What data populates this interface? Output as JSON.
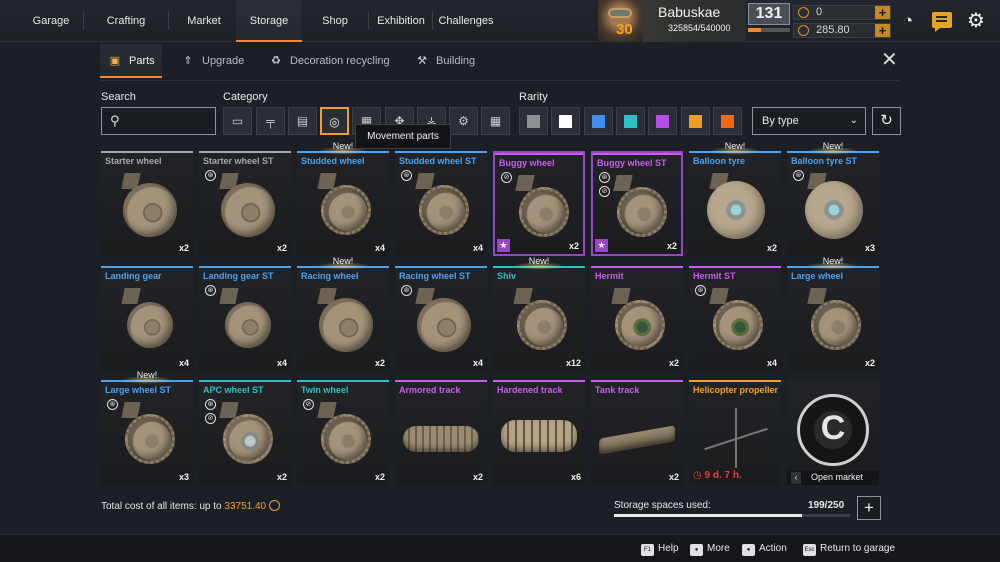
{
  "nav": {
    "items": [
      {
        "label": "Garage"
      },
      {
        "label": "Crafting"
      },
      {
        "label": "Market"
      },
      {
        "label": "Storage"
      },
      {
        "label": "Shop"
      },
      {
        "label": "Exhibition"
      },
      {
        "label": "Challenges"
      }
    ],
    "active": "Storage"
  },
  "profile": {
    "name": "Babuskae",
    "level": "30",
    "xp": "325854/540000",
    "rank": "131",
    "rank_progress": 0.3
  },
  "currencies": [
    {
      "icon": "coin-icon",
      "value": "0"
    },
    {
      "icon": "coin-icon",
      "value": "285.80"
    }
  ],
  "subtabs": [
    {
      "label": "Parts",
      "icon": "parts-icon"
    },
    {
      "label": "Upgrade",
      "icon": "upgrade-icon"
    },
    {
      "label": "Decoration recycling",
      "icon": "recycle-icon"
    },
    {
      "label": "Building",
      "icon": "building-icon"
    }
  ],
  "filters": {
    "search_label": "Search",
    "search_value": "",
    "category_label": "Category",
    "rarity_label": "Rarity",
    "sort_value": "By type",
    "tooltip": "Movement parts",
    "category_icons": [
      "cabin-icon",
      "weapon-icon",
      "module-icon",
      "wheel-icon",
      "frame-icon",
      "wing-icon",
      "engine-icon",
      "gear-cog-icon",
      "grid-icon"
    ],
    "rarity_colors": [
      "#8c8f93",
      "#ffffff",
      "#3d8ff2",
      "#2fbfc6",
      "#b64de6",
      "#f09e20",
      "#f26a10"
    ]
  },
  "items": [
    {
      "name": "Starter wheel",
      "count": "x2",
      "color": "#a8a8a8",
      "badges": [],
      "new": false,
      "shape": "big"
    },
    {
      "name": "Starter wheel ST",
      "count": "x2",
      "color": "#a8a8a8",
      "badges": [
        "st"
      ],
      "new": false,
      "shape": "big"
    },
    {
      "name": "Studded wheel",
      "count": "x4",
      "color": "#4aa3f5",
      "badges": [],
      "new": true,
      "new_label": "New!",
      "shape": "knob"
    },
    {
      "name": "Studded wheel ST",
      "count": "x4",
      "color": "#4aa3f5",
      "badges": [
        "st"
      ],
      "new": false,
      "shape": "knob"
    },
    {
      "name": "Buggy wheel",
      "count": "x2",
      "color": "#c85ef0",
      "badges": [
        "no"
      ],
      "epic": true,
      "new": false,
      "shape": "knob"
    },
    {
      "name": "Buggy wheel ST",
      "count": "x2",
      "color": "#c85ef0",
      "badges": [
        "st",
        "no"
      ],
      "epic": true,
      "new": false,
      "shape": "knob"
    },
    {
      "name": "Balloon tyre",
      "count": "x2",
      "color": "#4aa3f5",
      "badges": [],
      "new": true,
      "new_label": "New!",
      "shape": "balloon"
    },
    {
      "name": "Balloon tyre ST",
      "count": "x3",
      "color": "#4aa3f5",
      "badges": [
        "st"
      ],
      "new": true,
      "new_label": "New!",
      "shape": "balloon"
    },
    {
      "name": "Landing gear",
      "count": "x4",
      "color": "#4aa3f5",
      "badges": [],
      "new": false,
      "shape": "small"
    },
    {
      "name": "Landing gear ST",
      "count": "x4",
      "color": "#4aa3f5",
      "badges": [
        "st"
      ],
      "new": false,
      "shape": "small"
    },
    {
      "name": "Racing wheel",
      "count": "x2",
      "color": "#4aa3f5",
      "badges": [],
      "new": true,
      "new_label": "New!",
      "shape": "big"
    },
    {
      "name": "Racing wheel ST",
      "count": "x4",
      "color": "#4aa3f5",
      "badges": [
        "st"
      ],
      "new": false,
      "shape": "big"
    },
    {
      "name": "Shiv",
      "count": "x12",
      "color": "#2fbfc6",
      "badges": [],
      "new": true,
      "new_label": "New!",
      "shape": "knob"
    },
    {
      "name": "Hermit",
      "count": "x2",
      "color": "#c85ef0",
      "badges": [],
      "new": false,
      "shape": "green"
    },
    {
      "name": "Hermit ST",
      "count": "x4",
      "color": "#c85ef0",
      "badges": [
        "st"
      ],
      "new": false,
      "shape": "green"
    },
    {
      "name": "Large wheel",
      "count": "x2",
      "color": "#4aa3f5",
      "badges": [],
      "new": true,
      "new_label": "New!",
      "shape": "knob"
    },
    {
      "name": "Large wheel ST",
      "count": "x3",
      "color": "#4aa3f5",
      "badges": [
        "st"
      ],
      "new": true,
      "new_label": "New!",
      "shape": "knob"
    },
    {
      "name": "APC wheel ST",
      "count": "x2",
      "color": "#2fbfc6",
      "badges": [
        "st",
        "no"
      ],
      "new": false,
      "shape": "steel"
    },
    {
      "name": "Twin wheel",
      "count": "x2",
      "color": "#2fbfc6",
      "badges": [
        "no"
      ],
      "new": false,
      "shape": "knob"
    },
    {
      "name": "Armored track",
      "count": "x2",
      "color": "#c85ef0",
      "badges": [],
      "new": false,
      "shape": "track"
    },
    {
      "name": "Hardened track",
      "count": "x6",
      "color": "#c85ef0",
      "badges": [],
      "new": false,
      "shape": "track-hard"
    },
    {
      "name": "Tank track",
      "count": "x2",
      "color": "#c85ef0",
      "badges": [],
      "new": false,
      "shape": "track-tank"
    },
    {
      "name": "Helicopter propeller",
      "count": "",
      "color": "#f0a030",
      "badges": [],
      "new": false,
      "shape": "prop",
      "timer": "9 d. 7 h."
    },
    {
      "name": "",
      "count": "",
      "color": "",
      "badges": [],
      "new": false,
      "shape": "market",
      "market_label": "Open market"
    }
  ],
  "footer_stats": {
    "total_label": "Total cost of all items: up to",
    "total_value": "33751.40",
    "storage_label": "Storage spaces used:",
    "storage_value": "199/250",
    "storage_fraction": 0.796
  },
  "footer": [
    {
      "key": "F1",
      "label": "Help"
    },
    {
      "key": "",
      "label": "More"
    },
    {
      "key": "",
      "label": "Action"
    },
    {
      "key": "Esc",
      "label": "Return to garage"
    }
  ]
}
